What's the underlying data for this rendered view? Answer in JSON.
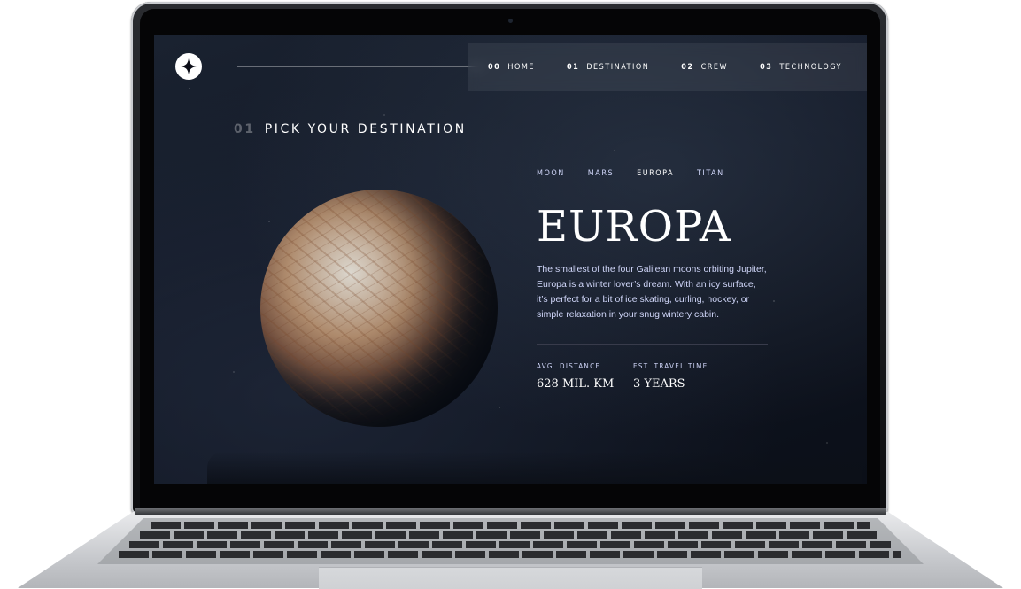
{
  "nav": {
    "items": [
      {
        "num": "00",
        "label": "HOME"
      },
      {
        "num": "01",
        "label": "DESTINATION"
      },
      {
        "num": "02",
        "label": "CREW"
      },
      {
        "num": "03",
        "label": "TECHNOLOGY"
      }
    ]
  },
  "page": {
    "heading_num": "01",
    "heading": "PICK YOUR DESTINATION"
  },
  "tabs": [
    "MOON",
    "MARS",
    "EUROPA",
    "TITAN"
  ],
  "active_tab": "EUROPA",
  "destination": {
    "name": "EUROPA",
    "description": "The smallest of the four Galilean moons orbiting Jupiter, Europa is a winter lover’s dream. With an icy surface, it’s perfect for a bit of ice skating, curling, hockey, or simple relaxation in your snug wintery cabin.",
    "stats": [
      {
        "label": "AVG. DISTANCE",
        "value": "628 MIL. KM"
      },
      {
        "label": "EST. TRAVEL TIME",
        "value": "3 YEARS"
      }
    ]
  },
  "colors": {
    "background": "#0b0d17",
    "accent_text": "#d0d6f9",
    "text": "#ffffff"
  },
  "icons": [
    "star-logo-icon"
  ]
}
